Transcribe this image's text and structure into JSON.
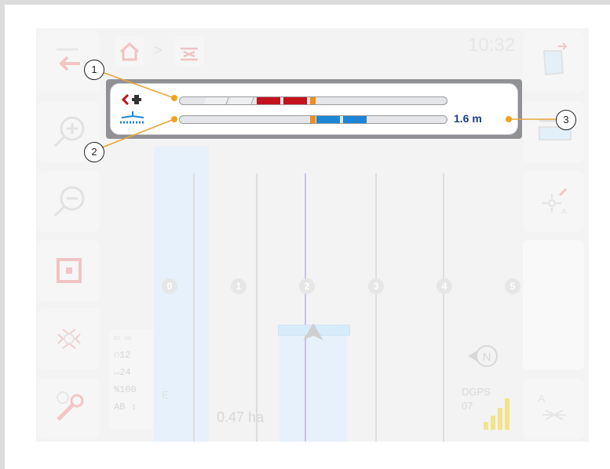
{
  "header": {
    "clock": "10:32",
    "breadcrumb_separator": ">"
  },
  "lightbar": {
    "distance": "1.6 m",
    "colors": {
      "red": "#c3131c",
      "blue": "#1d86d6",
      "orange": "#f28c1a"
    }
  },
  "callouts": [
    "1",
    "2",
    "3"
  ],
  "lanes": [
    "0",
    "1",
    "2",
    "3",
    "4",
    "5"
  ],
  "status": {
    "area": "0.47 ha",
    "speed": "12",
    "width": "24",
    "percent": "100",
    "ab_label": "AB ↕",
    "gps_type": "DGPS",
    "gps_sats": "07",
    "marker": "E"
  },
  "compass": {
    "label": "N"
  },
  "icons": {
    "left": [
      "back-icon",
      "zoom-in-icon",
      "zoom-out-icon",
      "fit-view-icon",
      "gps-calibration-icon",
      "settings-icon"
    ],
    "right": [
      "field-boundary-icon",
      "headland-icon",
      "set-point-a-icon",
      "ab-line-icon"
    ]
  }
}
